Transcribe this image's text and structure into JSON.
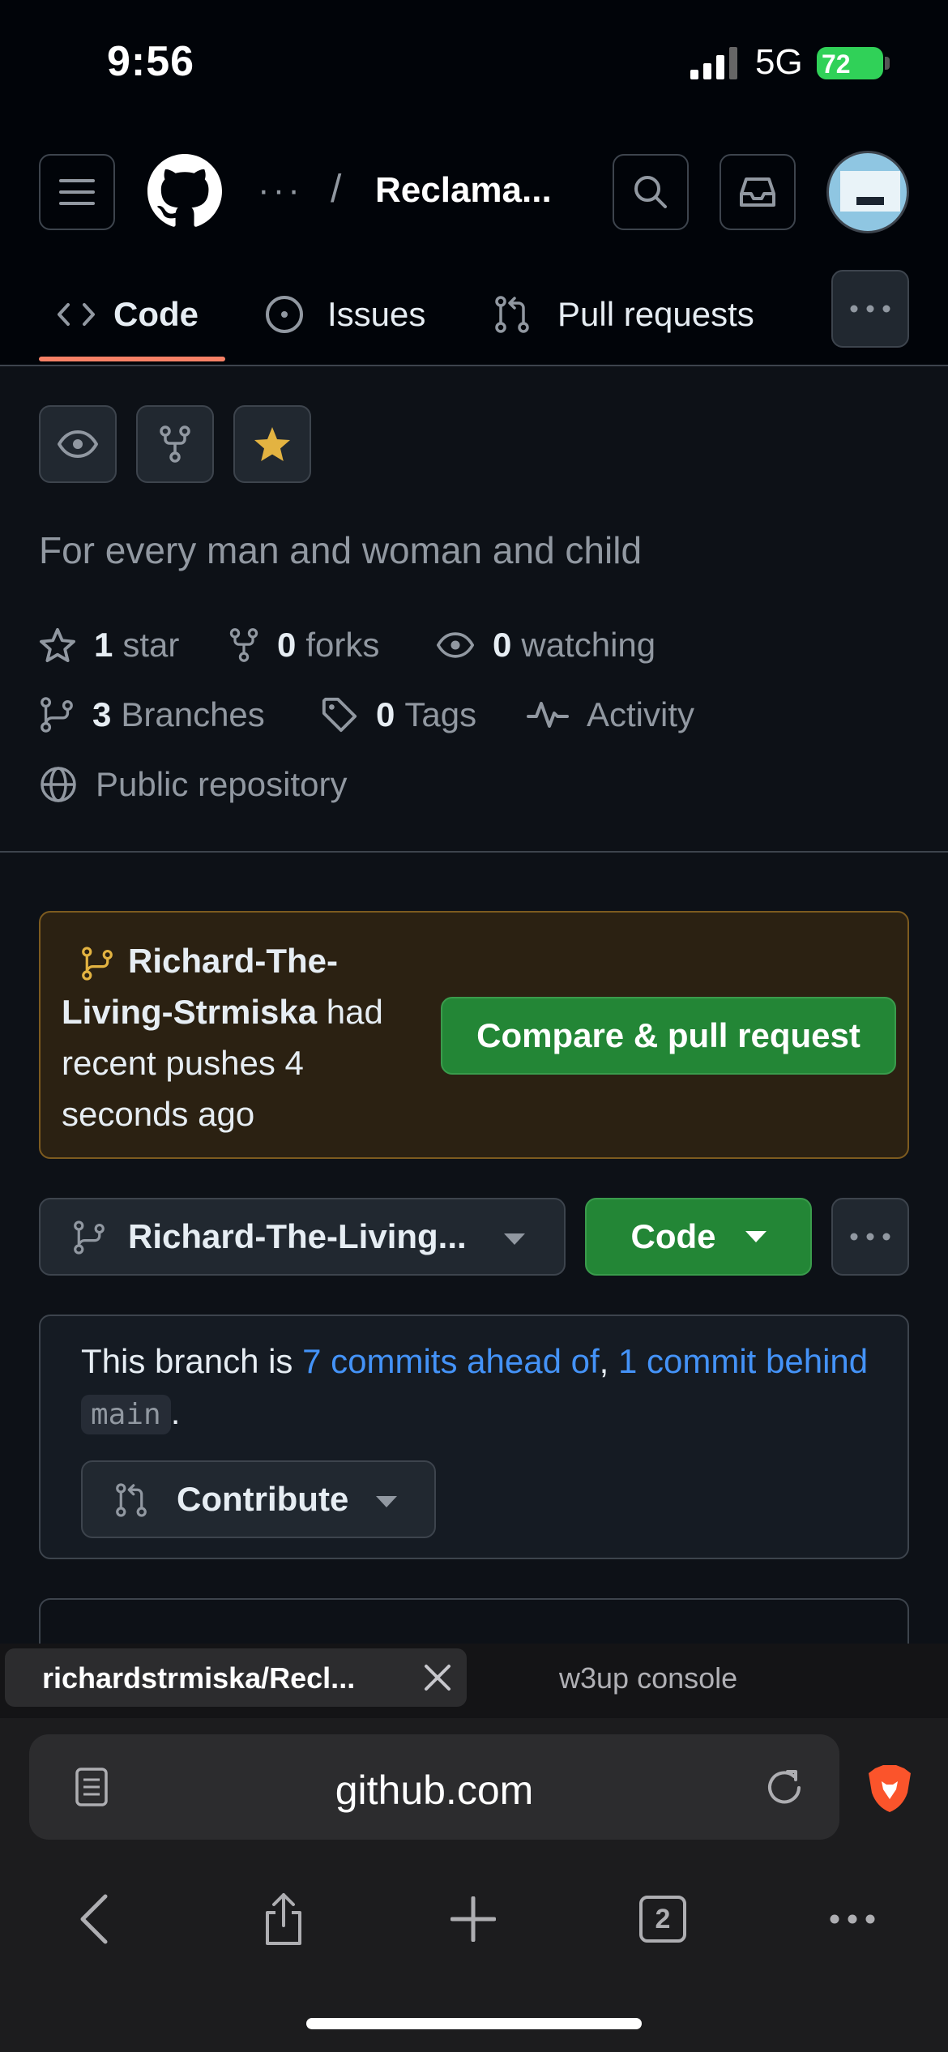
{
  "status_bar": {
    "time": "9:56",
    "network": "5G",
    "battery": "72"
  },
  "header": {
    "owner_placeholder": "···",
    "separator": "/",
    "repo_name": "Reclama...",
    "tabs": [
      {
        "label": "Code",
        "active": true
      },
      {
        "label": "Issues",
        "active": false
      },
      {
        "label": "Pull requests",
        "active": false
      }
    ]
  },
  "repo": {
    "description": "For every man and woman and child",
    "stats": {
      "stars_count": "1",
      "stars_label": "star",
      "forks_count": "0",
      "forks_label": "forks",
      "watching_count": "0",
      "watching_label": "watching",
      "branches_count": "3",
      "branches_label": "Branches",
      "tags_count": "0",
      "tags_label": "Tags",
      "activity_label": "Activity",
      "visibility_label": "Public repository"
    }
  },
  "push_banner": {
    "branch": "Richard-The-Living-Strmiska",
    "message": "had recent pushes 4 seconds ago",
    "button_label": "Compare & pull request"
  },
  "branch_bar": {
    "selected_branch": "Richard-The-Living...",
    "code_button": "Code"
  },
  "ahead_box": {
    "prefix": "This branch is",
    "ahead_link": "7 commits ahead of",
    "comma": ",",
    "behind_link": "1 commit behind",
    "base_branch": "main",
    "period": ".",
    "contribute_label": "Contribute"
  },
  "browser": {
    "active_tab_title": "richardstrmiska/Recl...",
    "inactive_tab_title": "w3up console",
    "url": "github.com",
    "tab_count": "2"
  },
  "colors": {
    "accent_underline": "#f78166",
    "primary_green": "#238636",
    "link_blue": "#4493f8",
    "star_gold": "#e3b341",
    "banner_border": "#7d5b1f",
    "brave_orange": "#fb542b"
  }
}
